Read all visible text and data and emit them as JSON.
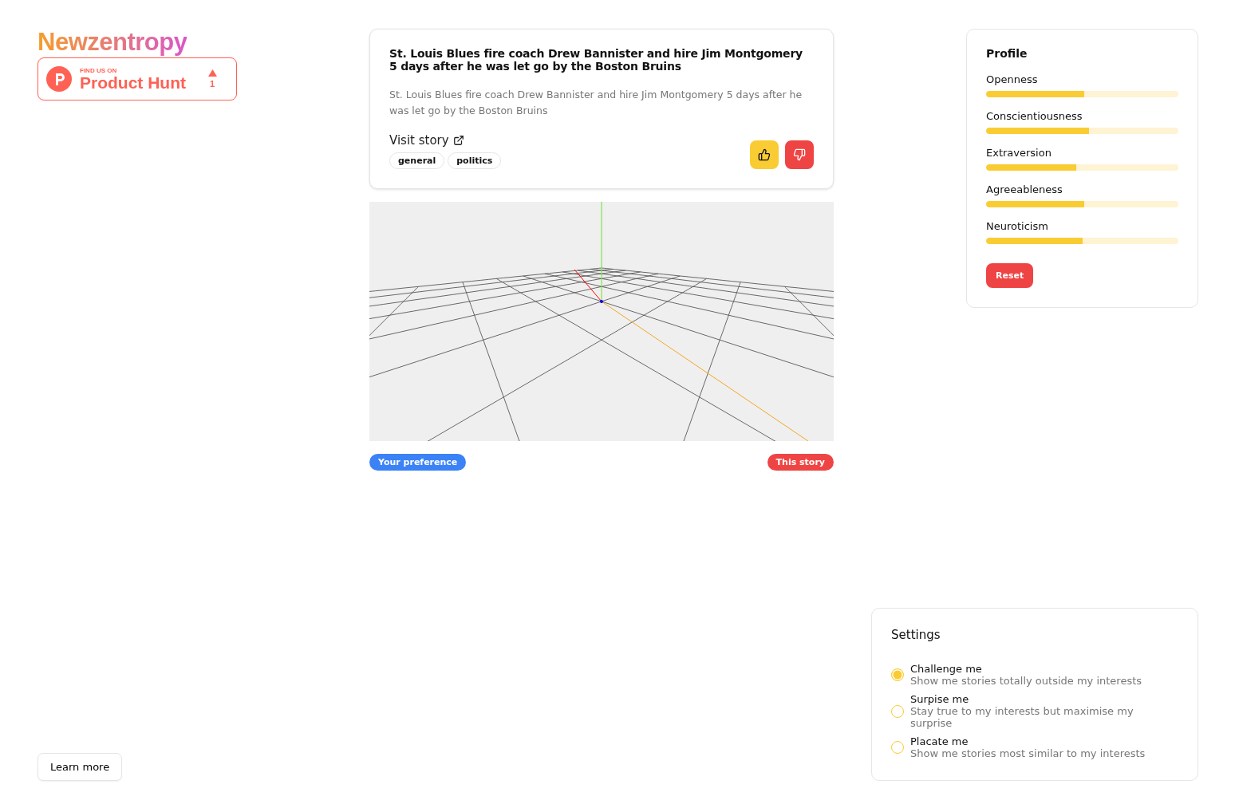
{
  "brand": {
    "logo": "Newzentropy",
    "badge": {
      "eyebrow": "FIND US ON",
      "name": "Product Hunt",
      "votes": "1"
    }
  },
  "story": {
    "title": "St. Louis Blues fire coach Drew Bannister and hire Jim Montgomery 5 days after he was let go by the Boston Bruins",
    "summary": "St. Louis Blues fire coach Drew Bannister and hire Jim Montgomery 5 days after he was let go by the Boston Bruins",
    "link": "Visit story",
    "tags": [
      "general",
      "politics"
    ]
  },
  "legend": [
    {
      "label": "Your preference",
      "color": "#3b82f6"
    },
    {
      "label": "This story",
      "color": "#ef4444"
    }
  ],
  "profile": {
    "title": "Profile",
    "traits": [
      {
        "name": "Openness",
        "level": 0.51
      },
      {
        "name": "Conscientiousness",
        "level": 0.535
      },
      {
        "name": "Extraversion",
        "level": 0.47
      },
      {
        "name": "Agreeableness",
        "level": 0.51
      },
      {
        "name": "Neuroticism",
        "level": 0.5
      }
    ],
    "reset": "Reset"
  },
  "learn_more": "Learn more",
  "settings": {
    "title": "Settings",
    "options": [
      {
        "label": "Challenge me",
        "description": "Show me stories totally outside my interests",
        "selected": true
      },
      {
        "label": "Surpise me",
        "description": "Stay true to my interests but maximise my surprise",
        "selected": false
      },
      {
        "label": "Placate me",
        "description": "Show me stories most similar to my interests",
        "selected": false
      }
    ]
  }
}
